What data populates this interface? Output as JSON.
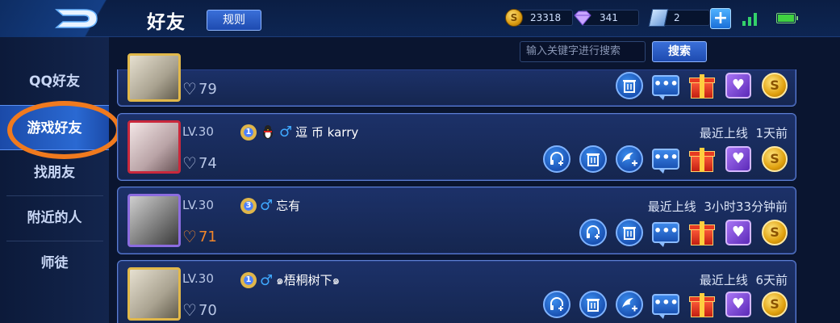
{
  "header": {
    "title": "好友",
    "rules_label": "规则",
    "resources": {
      "gold": "23318",
      "diamond": "341",
      "voucher": "2"
    },
    "signal_level": 3,
    "battery_level": 1.0
  },
  "sidebar": {
    "items": [
      {
        "label": "QQ好友"
      },
      {
        "label": "游戏好友"
      },
      {
        "label": "找朋友"
      },
      {
        "label": "附近的人"
      },
      {
        "label": "师徒"
      }
    ],
    "active_index": 1
  },
  "search": {
    "placeholder": "输入关键字进行搜索",
    "button_label": "搜索"
  },
  "friends": [
    {
      "intimacy": "79"
    },
    {
      "level": "LV.30",
      "rank": "1",
      "name": "逗 币  karry",
      "last_online_label": "最近上线",
      "last_online_value": "1天前",
      "intimacy": "74"
    },
    {
      "level": "LV.30",
      "rank": "3",
      "name": "忘有",
      "last_online_label": "最近上线",
      "last_online_value": "3小时33分钟前",
      "intimacy": "71"
    },
    {
      "level": "LV.30",
      "rank": "1",
      "name": "๑梧桐树下๑",
      "last_online_label": "最近上线",
      "last_online_value": "6天前",
      "intimacy": "70"
    }
  ],
  "icons": {
    "back": "back-arrow-icon",
    "coin": "gold-coin-icon",
    "gem": "diamond-icon",
    "voucher": "voucher-icon",
    "add": "plus-icon",
    "signal": "signal-icon",
    "battery": "battery-icon"
  },
  "colors": {
    "accent_orange": "#f07a1e",
    "male_blue": "#3fa9ff",
    "card_border": "#5d7fd1"
  }
}
